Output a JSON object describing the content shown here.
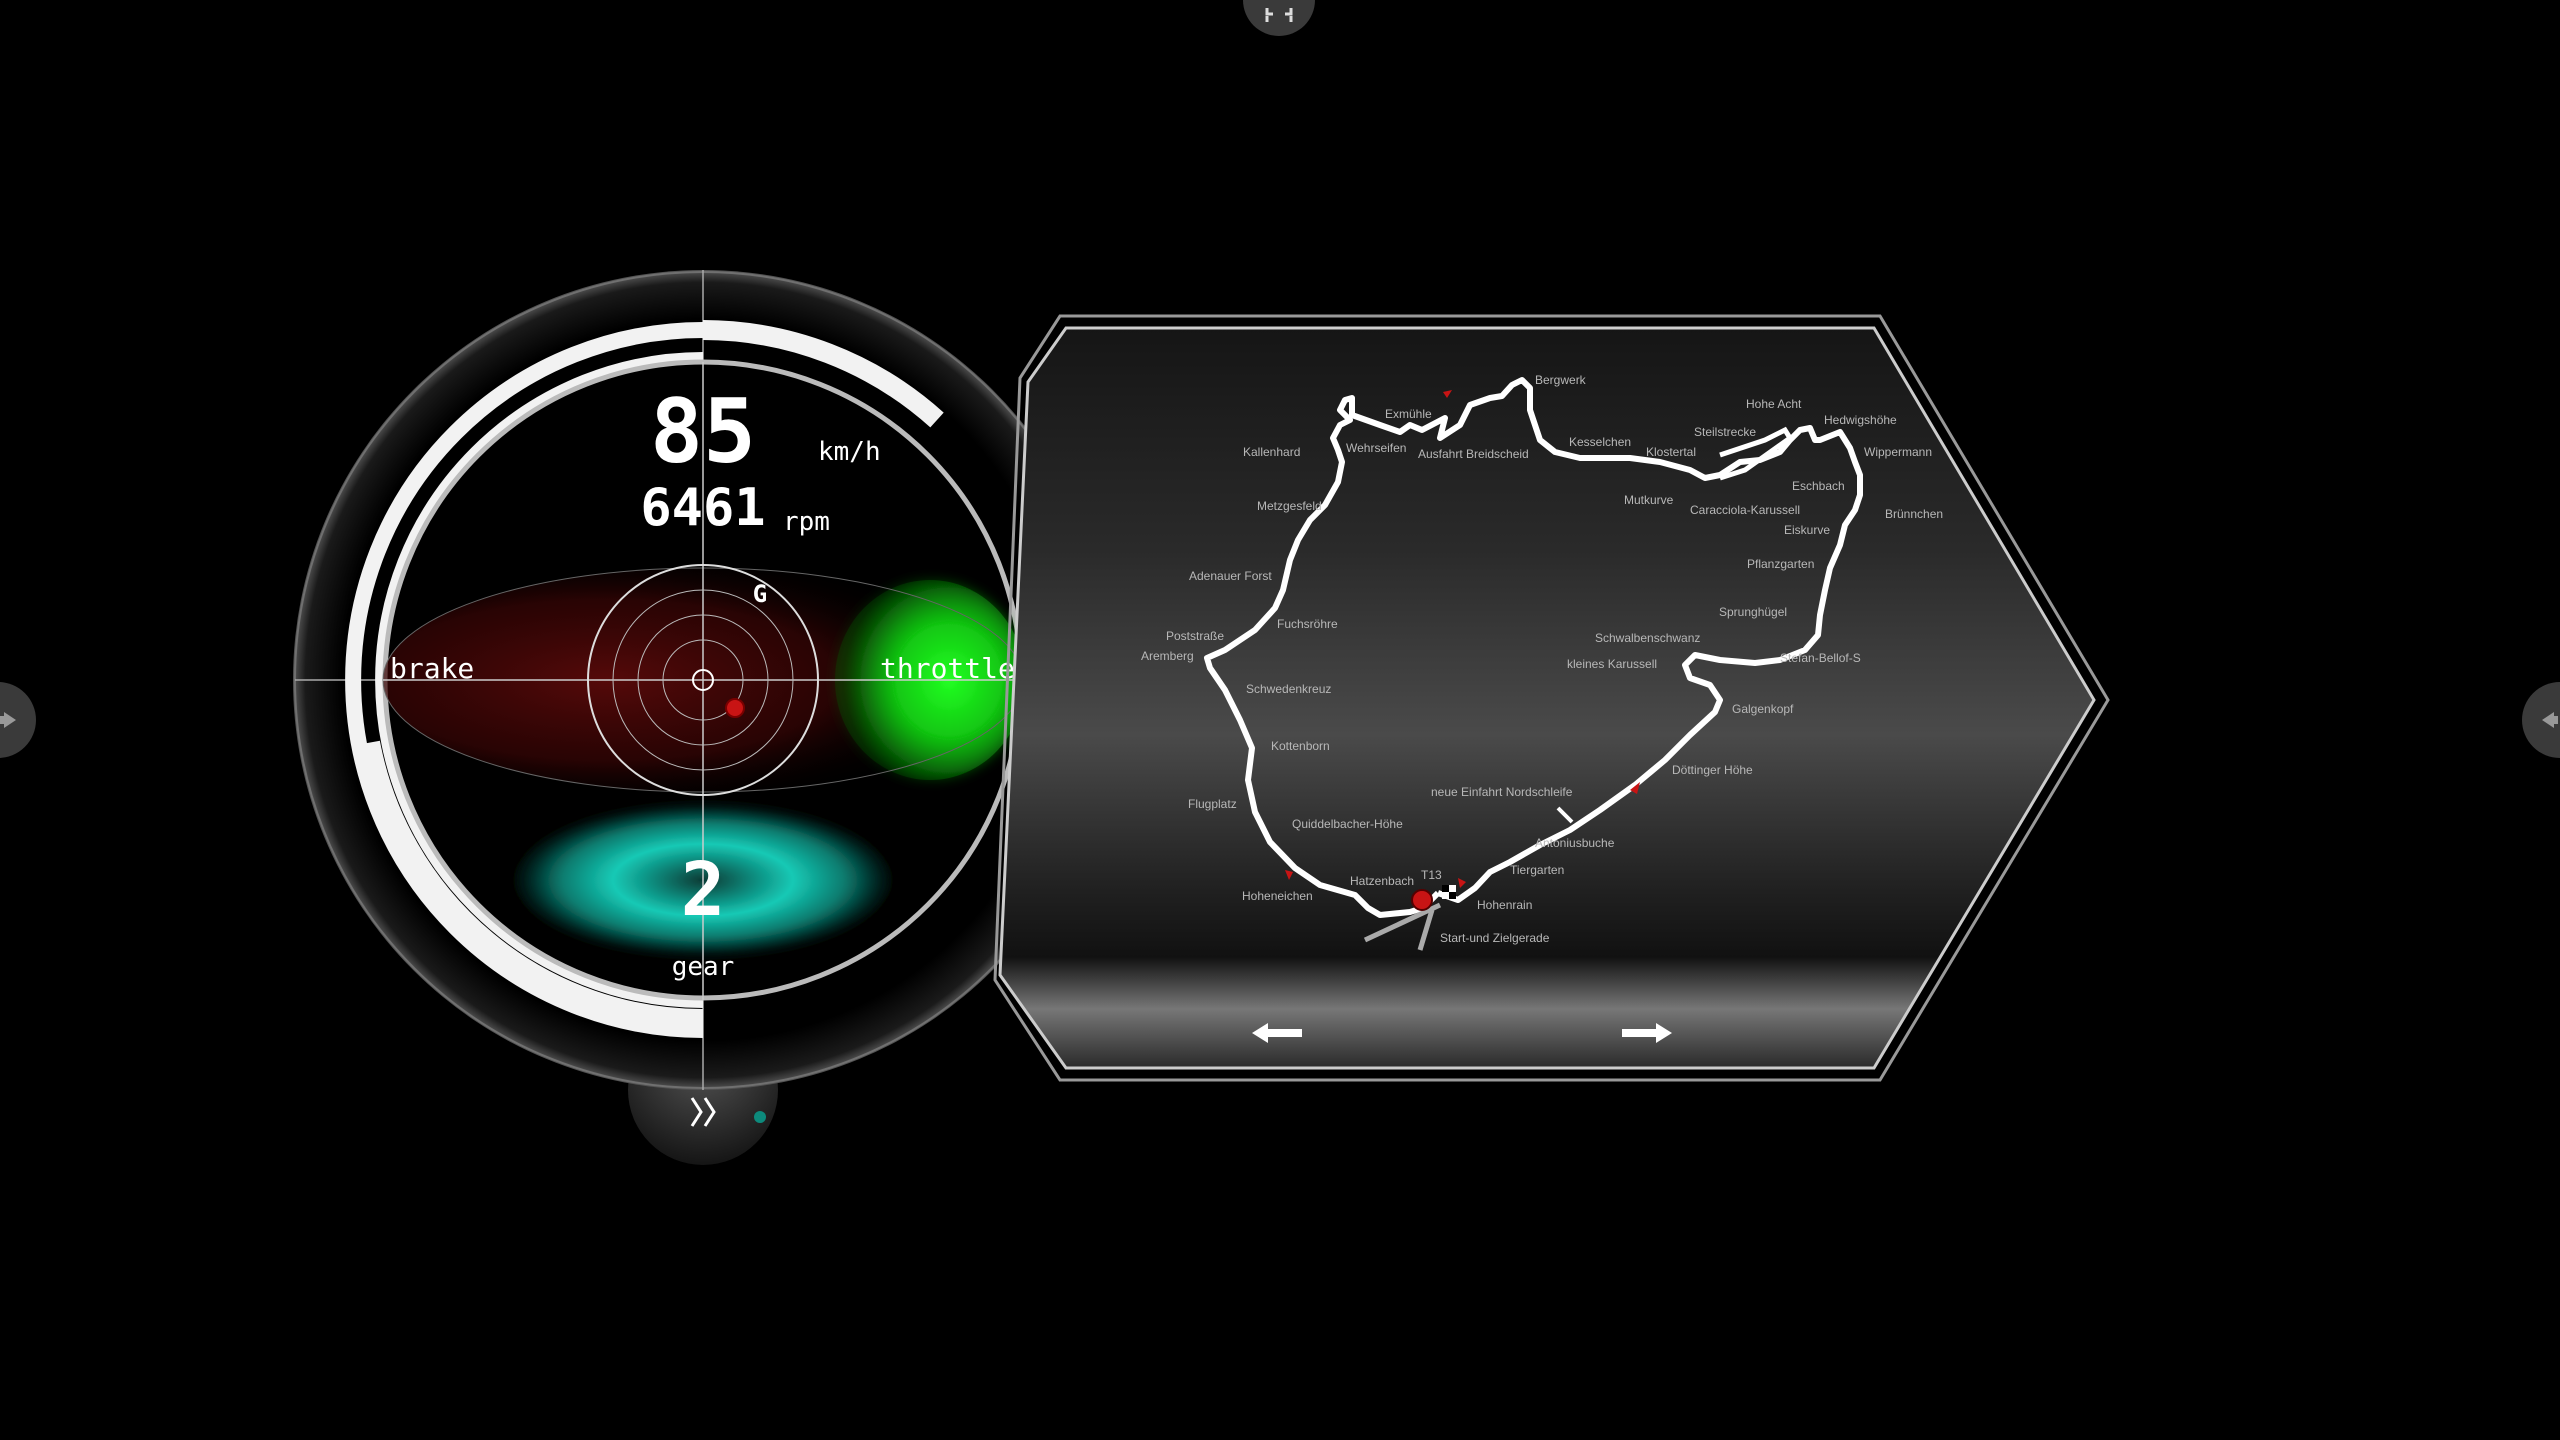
{
  "top_button": {
    "icon": "fullscreen-icon"
  },
  "side_buttons": {
    "left_icon": "arrow-right-icon",
    "right_icon": "arrow-left-icon"
  },
  "gauge": {
    "speed": "85",
    "speed_unit": "km/h",
    "rpm": "6461",
    "rpm_unit": "rpm",
    "g_label": "G",
    "brake_label": "brake",
    "throttle_label": "throttle",
    "gear": "2",
    "gear_label": "gear",
    "colors": {
      "brake": "#5a0a0a",
      "throttle": "#18ff18",
      "gear": "#15c9b5",
      "g_dot": "#c81414"
    }
  },
  "gauge_toggle": {
    "icon": "double-chevron-right-icon"
  },
  "track": {
    "turn_names": [
      "Bergwerk",
      "Exmühle",
      "Kallenhard",
      "Wehrseifen",
      "Ausfahrt Breidscheid",
      "Kesselchen",
      "Klostertal",
      "Steilstrecke",
      "Hohe Acht",
      "Hedwigshöhe",
      "Wippermann",
      "Eschbach",
      "Brünnchen",
      "Mutkurve",
      "Caracciola-Karussell",
      "Eiskurve",
      "Metzgesfeld",
      "Adenauer Forst",
      "Pflanzgarten",
      "Fuchsröhre",
      "Sprunghügel",
      "Poststraße",
      "Aremberg",
      "Schwalbenschwanz",
      "kleines Karussell",
      "Stefan-Bellof-S",
      "Schwedenkreuz",
      "Galgenkopf",
      "Kottenborn",
      "Döttinger Höhe",
      "neue Einfahrt Nordschleife",
      "Flugplatz",
      "Quiddelbacher-Höhe",
      "Antoniusbuche",
      "Tiergarten",
      "Hatzenbach",
      "T13",
      "Hohenrain",
      "Hoheneichen",
      "Start-und Zielgerade"
    ],
    "nav_prev_icon": "arrow-left-icon",
    "nav_next_icon": "arrow-right-icon"
  }
}
